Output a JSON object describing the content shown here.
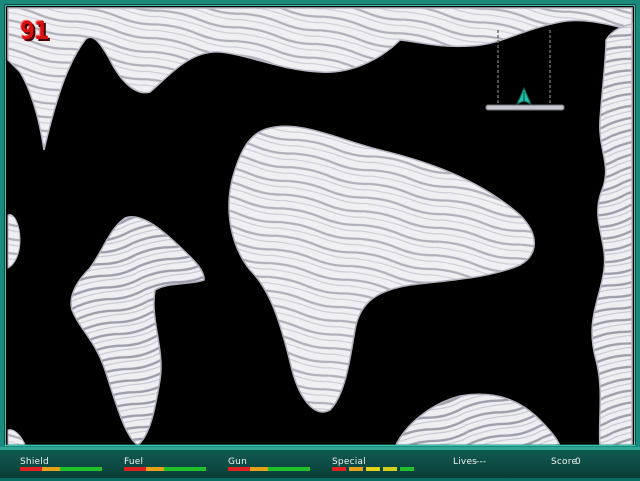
{
  "counter": "91",
  "hud": {
    "shield": {
      "label": "Shield",
      "level": 1.0
    },
    "fuel": {
      "label": "Fuel",
      "level": 1.0
    },
    "gun": {
      "label": "Gun",
      "level": 1.0
    },
    "special": {
      "label": "Special"
    },
    "lives": {
      "label": "Lives",
      "value": "---"
    },
    "score": {
      "label": "Score",
      "value": "0"
    }
  },
  "colors": {
    "frame": "#1a8a7d",
    "rock": "#f0f0f4",
    "rock_shadow": "#7a7a88",
    "space": "#000000",
    "ship": "#1fbfa8",
    "meter_red": "#e02020",
    "meter_yellow": "#e6d21a",
    "meter_green": "#22c02a"
  },
  "icons": {
    "ship": "ship-icon",
    "landing_pad": "landing-pad-icon"
  }
}
